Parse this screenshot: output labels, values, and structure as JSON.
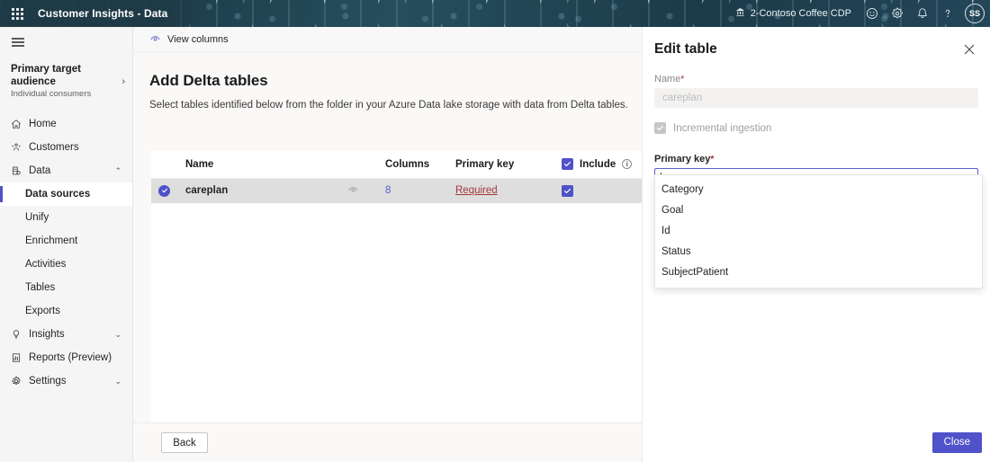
{
  "topbar": {
    "waffle_icon": "app-launcher-icon",
    "app_title": "Customer Insights - Data",
    "environment": "2-Contoso Coffee CDP",
    "environment_icon": "environment-icon",
    "feedback_icon": "smiley-feedback-icon",
    "settings_icon": "gear-icon",
    "notifications_icon": "bell-icon",
    "help_icon": "question-mark-icon",
    "avatar_initials": "SS"
  },
  "sidebar": {
    "hamburger_icon": "hamburger-menu-icon",
    "audience": {
      "title": "Primary target audience",
      "subtitle": "Individual consumers",
      "chevron": "›"
    },
    "items": [
      {
        "label": "Home",
        "icon": "home-icon",
        "level": "top",
        "caret": "",
        "active": false
      },
      {
        "label": "Customers",
        "icon": "people-icon",
        "level": "top",
        "caret": "",
        "active": false
      },
      {
        "label": "Data",
        "icon": "database-icon",
        "level": "top",
        "caret": "⌃",
        "active": false
      },
      {
        "label": "Data sources",
        "icon": "",
        "level": "sub",
        "caret": "",
        "active": true
      },
      {
        "label": "Unify",
        "icon": "",
        "level": "sub",
        "caret": "",
        "active": false
      },
      {
        "label": "Enrichment",
        "icon": "",
        "level": "sub",
        "caret": "",
        "active": false
      },
      {
        "label": "Activities",
        "icon": "",
        "level": "sub",
        "caret": "",
        "active": false
      },
      {
        "label": "Tables",
        "icon": "",
        "level": "sub",
        "caret": "",
        "active": false
      },
      {
        "label": "Exports",
        "icon": "",
        "level": "sub",
        "caret": "",
        "active": false
      },
      {
        "label": "Insights",
        "icon": "lightbulb-icon",
        "level": "top",
        "caret": "⌄",
        "active": false
      },
      {
        "label": "Reports (Preview)",
        "icon": "report-icon",
        "level": "top",
        "caret": "",
        "active": false
      },
      {
        "label": "Settings",
        "icon": "gear-icon",
        "level": "top",
        "caret": "⌄",
        "active": false
      }
    ]
  },
  "main": {
    "command_bar": {
      "view_columns_label": "View columns",
      "view_columns_icon": "eye-icon"
    },
    "page_title": "Add Delta tables",
    "page_subtitle": "Select tables identified below from the folder in your Azure Data lake storage with data from Delta tables.",
    "table": {
      "headers": {
        "name": "Name",
        "columns": "Columns",
        "primary_key": "Primary key",
        "include": "Include",
        "include_info_icon": "info-icon",
        "include_header_checked": true
      },
      "rows": [
        {
          "selected": true,
          "name": "careplan",
          "eye_icon": "eye-icon",
          "columns": "8",
          "primary_key": "Required",
          "include_checked": true
        }
      ]
    },
    "footer": {
      "back_label": "Back"
    }
  },
  "panel": {
    "title": "Edit table",
    "close_icon": "close-icon",
    "name_label": "Name",
    "name_required_mark": "*",
    "name_value": "careplan",
    "incremental_label": "Incremental ingestion",
    "incremental_checked": true,
    "incremental_disabled": true,
    "primary_key_label": "Primary key",
    "primary_key_required_mark": "*",
    "primary_key_value": "",
    "primary_key_chevron_icon": "chevron-down-icon",
    "options": [
      "Category",
      "Goal",
      "Id",
      "Status",
      "SubjectPatient"
    ],
    "close_button_label": "Close"
  },
  "colors": {
    "accent": "#4f52c9",
    "banner": "#20414f",
    "link": "#5b5fc7",
    "danger": "#a4373a",
    "row_selected": "#dedede"
  }
}
